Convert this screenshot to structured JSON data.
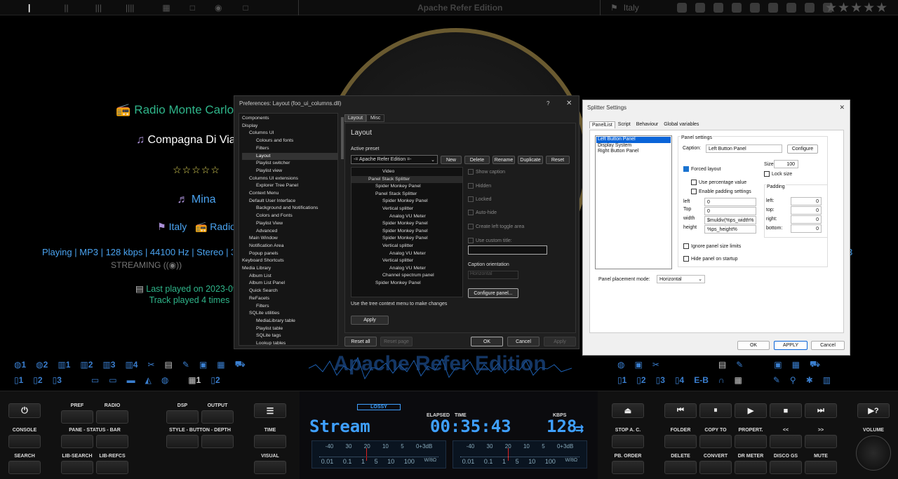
{
  "topbar": {
    "center_title": "Apache Refer Edition",
    "location": "Italy"
  },
  "now_playing": {
    "station": "Radio Monte Carlo ☆ Mina",
    "title": "Compagna Di Viaggio",
    "rating": "☆☆☆☆☆",
    "artist": "Mina",
    "country": "Italy",
    "genre": "Radio",
    "tech": "Playing | MP3 | 128 kbps | 44100 Hz | Stereo | 3",
    "tech_right": "3",
    "streaming": "STREAMING",
    "last_played": "Last played on 2023-09-16",
    "play_count": "Track played 4 times"
  },
  "mini_left_row1": [
    "1",
    "2",
    "1",
    "2",
    "3",
    "4"
  ],
  "mini_left_row2": [
    "1",
    "2",
    "3",
    "1",
    "2"
  ],
  "mini_right_row1": [],
  "mini_right_row2": [
    "1",
    "2",
    "3",
    "4",
    "E-B"
  ],
  "wave_title": "Apache Refer Edition",
  "controls_left": {
    "row1": [
      "PREF",
      "RADIO",
      "DSP",
      "OUTPUT"
    ],
    "row2": [
      "CONSOLE",
      "PANE - STATUS - BAR",
      "STYLE - BUTTON - DEPTH",
      "TIME"
    ],
    "row3": [
      "SEARCH",
      "LIB-SEARCH",
      "LIB-REFCS",
      "VISUAL"
    ]
  },
  "display": {
    "format": "LOSSY",
    "elapsed_label": "ELAPSED",
    "time_label": "TIME",
    "kbps_label": "KBPS",
    "stream": "Stream",
    "time": "00:35:43",
    "kbps": "128",
    "vu_scale_top": [
      "-40",
      "30",
      "20",
      "10",
      "5",
      "0+3dB"
    ],
    "vu_scale_bottom": [
      "0.01",
      "0.1",
      "1",
      "5",
      "10",
      "100",
      "W/8Ω"
    ]
  },
  "controls_right": {
    "row2": [
      "STOP A. C.",
      "FOLDER",
      "COPY TO",
      "PROPERT.",
      "<<",
      ">>",
      "VOLUME"
    ],
    "row3": [
      "PB. ORDER",
      "DELETE",
      "CONVERT",
      "DR METER",
      "DISCO GS",
      "MUTE"
    ]
  },
  "prefs": {
    "title": "Preferences: Layout (foo_ui_columns.dll)",
    "tree": [
      {
        "t": "Components",
        "l": 0
      },
      {
        "t": "Display",
        "l": 0
      },
      {
        "t": "Columns UI",
        "l": 1
      },
      {
        "t": "Colours and fonts",
        "l": 2
      },
      {
        "t": "Filters",
        "l": 2
      },
      {
        "t": "Layout",
        "l": 2
      },
      {
        "t": "Playlist switcher",
        "l": 2
      },
      {
        "t": "Playlist view",
        "l": 2
      },
      {
        "t": "Columns UI extensions",
        "l": 1
      },
      {
        "t": "Explorer Tree Panel",
        "l": 2
      },
      {
        "t": "Context Menu",
        "l": 1
      },
      {
        "t": "Default User Interface",
        "l": 1
      },
      {
        "t": "Background and Notifications",
        "l": 2
      },
      {
        "t": "Colors and Fonts",
        "l": 2
      },
      {
        "t": "Playlist View",
        "l": 2
      },
      {
        "t": "Advanced",
        "l": 2
      },
      {
        "t": "Main Window",
        "l": 1
      },
      {
        "t": "Notification Area",
        "l": 1
      },
      {
        "t": "Popup panels",
        "l": 1
      },
      {
        "t": "Keyboard Shortcuts",
        "l": 0
      },
      {
        "t": "Media Library",
        "l": 0
      },
      {
        "t": "Album List",
        "l": 1
      },
      {
        "t": "Album List Panel",
        "l": 1
      },
      {
        "t": "Quick Search",
        "l": 1
      },
      {
        "t": "ReFacets",
        "l": 1
      },
      {
        "t": "Filters",
        "l": 2
      },
      {
        "t": "SQLite utilities",
        "l": 1
      },
      {
        "t": "MediaLibrary table",
        "l": 2
      },
      {
        "t": "Playlist table",
        "l": 2
      },
      {
        "t": "SQLite tags",
        "l": 2
      },
      {
        "t": "Lookup tables",
        "l": 2
      }
    ],
    "tabs": [
      "Layout",
      "Misc"
    ],
    "heading": "Layout",
    "active_preset_label": "Active preset",
    "preset": "-= Apache Refer Edition =-",
    "preset_buttons": [
      "New",
      "Delete",
      "Rename",
      "Duplicate",
      "Reset"
    ],
    "layout_tree": [
      {
        "t": "Video",
        "l": 3
      },
      {
        "t": "Panel Stack Splitter",
        "l": 1
      },
      {
        "t": "Spider Monkey Panel",
        "l": 2
      },
      {
        "t": "Panel Stack Splitter",
        "l": 2
      },
      {
        "t": "Spider Monkey Panel",
        "l": 3
      },
      {
        "t": "Vertical splitter",
        "l": 3
      },
      {
        "t": "Analog VU Meter",
        "l": 4
      },
      {
        "t": "Spider Monkey Panel",
        "l": 3
      },
      {
        "t": "Spider Monkey Panel",
        "l": 3
      },
      {
        "t": "Spider Monkey Panel",
        "l": 3
      },
      {
        "t": "Vertical splitter",
        "l": 3
      },
      {
        "t": "Analog VU Meter",
        "l": 4
      },
      {
        "t": "Vertical splitter",
        "l": 3
      },
      {
        "t": "Analog VU Meter",
        "l": 4
      },
      {
        "t": "Channel spectrum panel",
        "l": 3
      },
      {
        "t": "Spider Monkey Panel",
        "l": 2
      }
    ],
    "options": [
      "Show caption",
      "Hidden",
      "Locked",
      "Auto-hide",
      "Create left toggle area",
      "Use custom title:"
    ],
    "caption_orientation_label": "Caption orientation",
    "caption_orientation": "Horizontal",
    "configure_panel": "Configure panel...",
    "hint": "Use the tree context menu to make changes",
    "apply": "Apply",
    "reset_all": "Reset all",
    "reset_page": "Reset page",
    "ok": "OK",
    "cancel": "Cancel",
    "apply2": "Apply"
  },
  "splitter": {
    "title": "Splitter Settings",
    "tabs": [
      "PanelList",
      "Script",
      "Behaviour",
      "Global variables"
    ],
    "panels": [
      "Left Button Panel",
      "Display System",
      "Right Button Panel"
    ],
    "panel_settings": "Panel settings",
    "caption_label": "Caption:",
    "caption": "Left Button Panel",
    "configure": "Configure",
    "size_label": "Size:",
    "size": "100",
    "forced_layout": "Forced layout",
    "lock_size": "Lock size",
    "use_percentage": "Use percentage value",
    "enable_padding": "Enable padding settings",
    "padding_label": "Padding",
    "left_label": "left",
    "top_label": "Top",
    "width_label": "width",
    "height_label": "height",
    "left": "0",
    "top": "0",
    "width": "$muldiv(%ps_width%",
    "height": "%ps_height%",
    "pad_left_label": "left:",
    "pad_top_label": "top:",
    "pad_right_label": "right:",
    "pad_bottom_label": "bottom:",
    "pad_left": "0",
    "pad_top": "0",
    "pad_right": "0",
    "pad_bottom": "0",
    "ignore_limits": "Ignore panel size limits",
    "hide_startup": "Hide panel on startup",
    "placement_label": "Panel placement mode:",
    "placement": "Horizontal",
    "ok": "OK",
    "apply": "APPLY",
    "cancel": "Cancel"
  }
}
